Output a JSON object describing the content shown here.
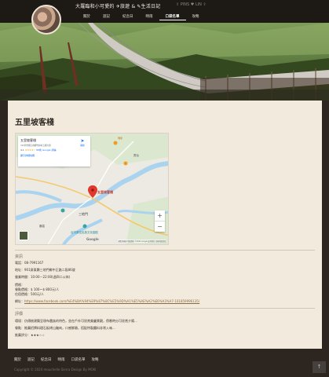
{
  "header": {
    "site_title": "大羅臨和小可愛的 ✈旅遊 & ✎生活日記",
    "social": "⇪ PINS ♥ LIN ⇪",
    "nav": [
      "關於",
      "遊記",
      "紀念日",
      "晴雨",
      "口袋名單",
      "攻略"
    ],
    "active_index": 4
  },
  "post": {
    "title": "五里坡客棧"
  },
  "map": {
    "place_name": "五里坡客棧",
    "place_address": "315新竹縣五峰鄉竹林村五鄰六號",
    "rating": "4.1",
    "stars": "★★★★☆",
    "reviews": "88則 Google 評論",
    "larger_map": "顯示詳細地圖",
    "directions": "路線",
    "pin_label": "五里坡客棧",
    "labels": [
      "三地門",
      "台灣原住民族文化園區",
      "山地門",
      "瑪家",
      "賽嘉",
      "霧台"
    ],
    "zoom_in": "+",
    "zoom_out": "−",
    "google": "Google",
    "footer": "鍵盤快捷鍵  地圖資料 ©2024 Google  使用條款  回報地圖錯誤"
  },
  "info": {
    "section_title": "資訊",
    "phone": "電話：08-7991167",
    "address": "地址：901屏東縣三地門鄉中正路二段86號",
    "hours": "營業時間：10:00－22:00(週四二公休)",
    "price_title": "價格：",
    "price_1": "餐點價格：$ 100～$ 800元/人",
    "price_2": "住宿價格：500元/人",
    "web_prefix": "網址：",
    "web_url": "https://www.facebook.com/%E4%BA%94%E9%87%8C%E5%9D%A1%E5%AE%A2%E6%A3%A7-101859996135/"
  },
  "review": {
    "section_title": "評價",
    "env": "環境：仿傳統建築呈現布農族的特色，坐在戶外可欣賞美麗景觀，傍晚時分可欣賞夕陽...",
    "food": "餐點：推薦招牌料理石板烤山豬肉，口感鮮嫩，搭配特製醬料非常入味...",
    "rating": "推薦評分：★★★☆☆"
  },
  "footer": {
    "nav": [
      "關於",
      "遊記",
      "紀念日",
      "晴雨",
      "口袋名單",
      "攻略"
    ],
    "copyright": "Copyright © 2024 mouchelle Sierra Design By MOKI",
    "to_top": "↑"
  }
}
